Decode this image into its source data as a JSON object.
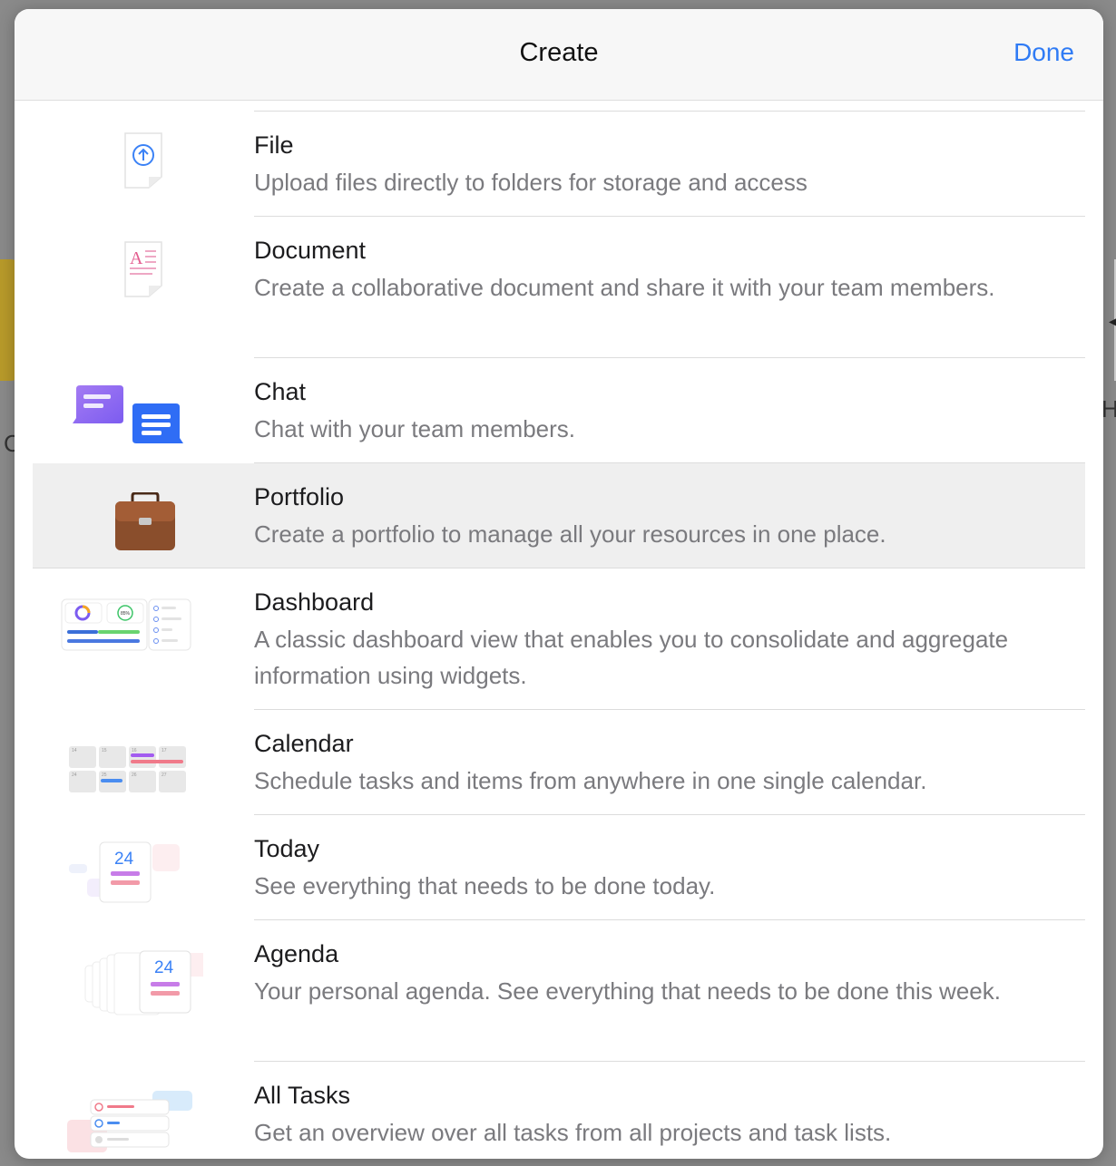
{
  "header": {
    "title": "Create",
    "done_label": "Done"
  },
  "background": {
    "left_letter": "C",
    "right_letter": "H"
  },
  "items": [
    {
      "title": "File",
      "description": "Upload files directly to folders for storage and access",
      "icon": "file-upload-icon"
    },
    {
      "title": "Document",
      "description": "Create a collaborative document and share it with your team members.",
      "icon": "document-icon"
    },
    {
      "title": "Chat",
      "description": "Chat with your team members.",
      "icon": "chat-bubbles-icon"
    },
    {
      "title": "Portfolio",
      "description": "Create a portfolio to manage all your resources in one place.",
      "icon": "briefcase-icon",
      "selected": true
    },
    {
      "title": "Dashboard",
      "description": "A classic dashboard view that enables you to consolidate and aggregate information using widgets.",
      "icon": "dashboard-widgets-icon"
    },
    {
      "title": "Calendar",
      "description": "Schedule tasks and items from anywhere in one single calendar.",
      "icon": "calendar-grid-icon"
    },
    {
      "title": "Today",
      "description": "See everything that needs to be done today.",
      "icon": "today-card-icon",
      "day": "24"
    },
    {
      "title": "Agenda",
      "description": "Your personal agenda. See everything that needs to be done this week.",
      "icon": "agenda-cards-icon",
      "day": "24"
    },
    {
      "title": "All Tasks",
      "description": "Get an overview over all tasks from all projects and task lists.",
      "icon": "task-list-icon"
    }
  ],
  "icons": {
    "document_glyph": "A",
    "dashboard_percent": "85%",
    "calendar_days": [
      "14",
      "15",
      "16",
      "17",
      "24",
      "25",
      "26",
      "27"
    ]
  },
  "colors": {
    "accent": "#2f7bf5",
    "selected_row": "#efefef"
  }
}
